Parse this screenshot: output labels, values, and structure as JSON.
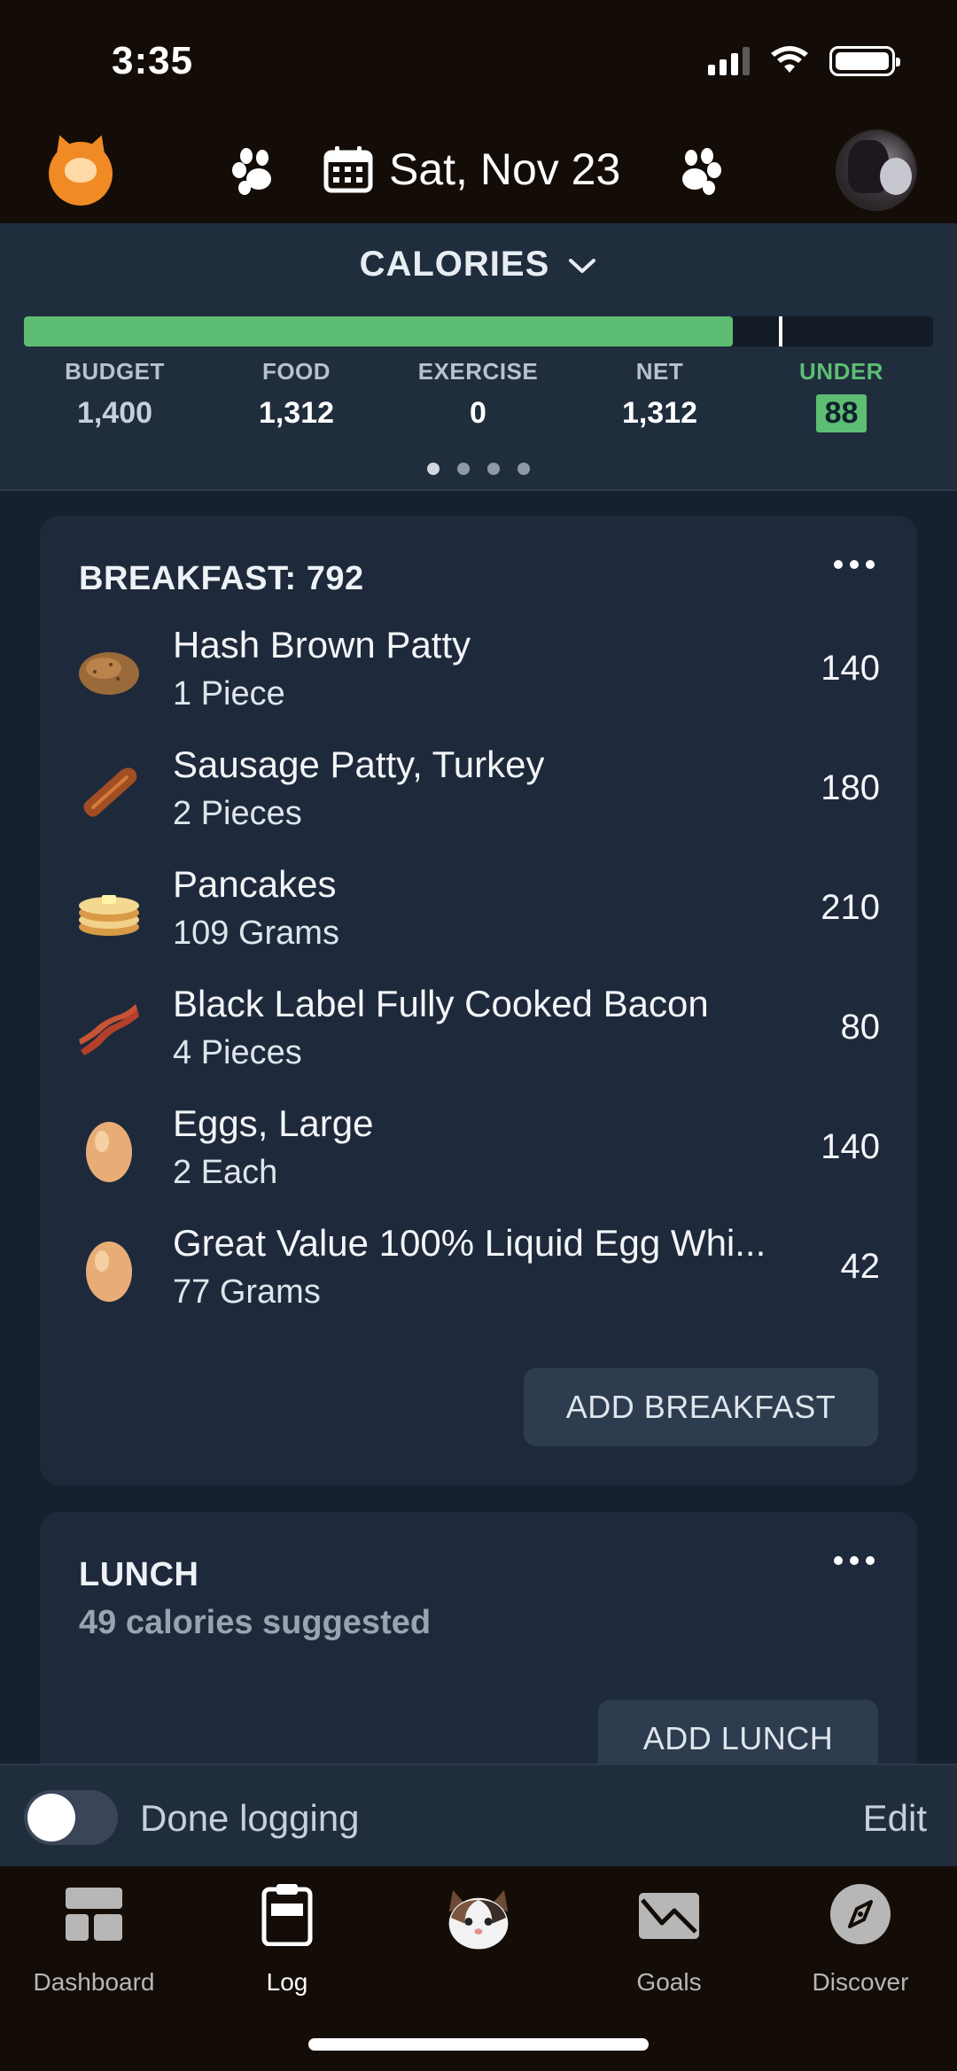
{
  "status_bar": {
    "time": "3:35"
  },
  "header": {
    "date": "Sat, Nov 23"
  },
  "summary": {
    "title": "CALORIES",
    "progress_fraction": 0.78,
    "stats": [
      {
        "label": "BUDGET",
        "value": "1,400"
      },
      {
        "label": "FOOD",
        "value": "1,312"
      },
      {
        "label": "EXERCISE",
        "value": "0"
      },
      {
        "label": "NET",
        "value": "1,312"
      },
      {
        "label": "UNDER",
        "value": "88"
      }
    ],
    "page_count": 4,
    "active_page": 0
  },
  "breakfast": {
    "title": "BREAKFAST: 792",
    "items": [
      {
        "name": "Hash Brown Patty",
        "qty": "1 Piece",
        "cal": "140",
        "icon": "potato-icon"
      },
      {
        "name": "Sausage Patty, Turkey",
        "qty": "2 Pieces",
        "cal": "180",
        "icon": "sausage-icon"
      },
      {
        "name": "Pancakes",
        "qty": "109 Grams",
        "cal": "210",
        "icon": "pancakes-icon"
      },
      {
        "name": "Black Label Fully Cooked Bacon",
        "qty": "4 Pieces",
        "cal": "80",
        "icon": "bacon-icon"
      },
      {
        "name": "Eggs, Large",
        "qty": "2 Each",
        "cal": "140",
        "icon": "egg-icon"
      },
      {
        "name": "Great Value 100% Liquid Egg Whi...",
        "qty": "77 Grams",
        "cal": "42",
        "icon": "egg-icon"
      }
    ],
    "add_label": "ADD BREAKFAST"
  },
  "lunch": {
    "title": "LUNCH",
    "subtitle": "49 calories suggested",
    "add_label": "ADD LUNCH"
  },
  "done_bar": {
    "label": "Done logging",
    "edit": "Edit",
    "toggle_on": false
  },
  "tabs": [
    {
      "label": "Dashboard",
      "icon": "dashboard-icon"
    },
    {
      "label": "Log",
      "icon": "log-icon",
      "active": true
    },
    {
      "label": "",
      "icon": "cat-mascot-icon"
    },
    {
      "label": "Goals",
      "icon": "goals-icon"
    },
    {
      "label": "Discover",
      "icon": "compass-icon"
    }
  ],
  "colors": {
    "accent_green": "#5dbd72",
    "header_bg": "#140d07",
    "page_bg": "#16202e",
    "card_bg": "#1e2a3b",
    "logo_orange": "#f08a24"
  }
}
